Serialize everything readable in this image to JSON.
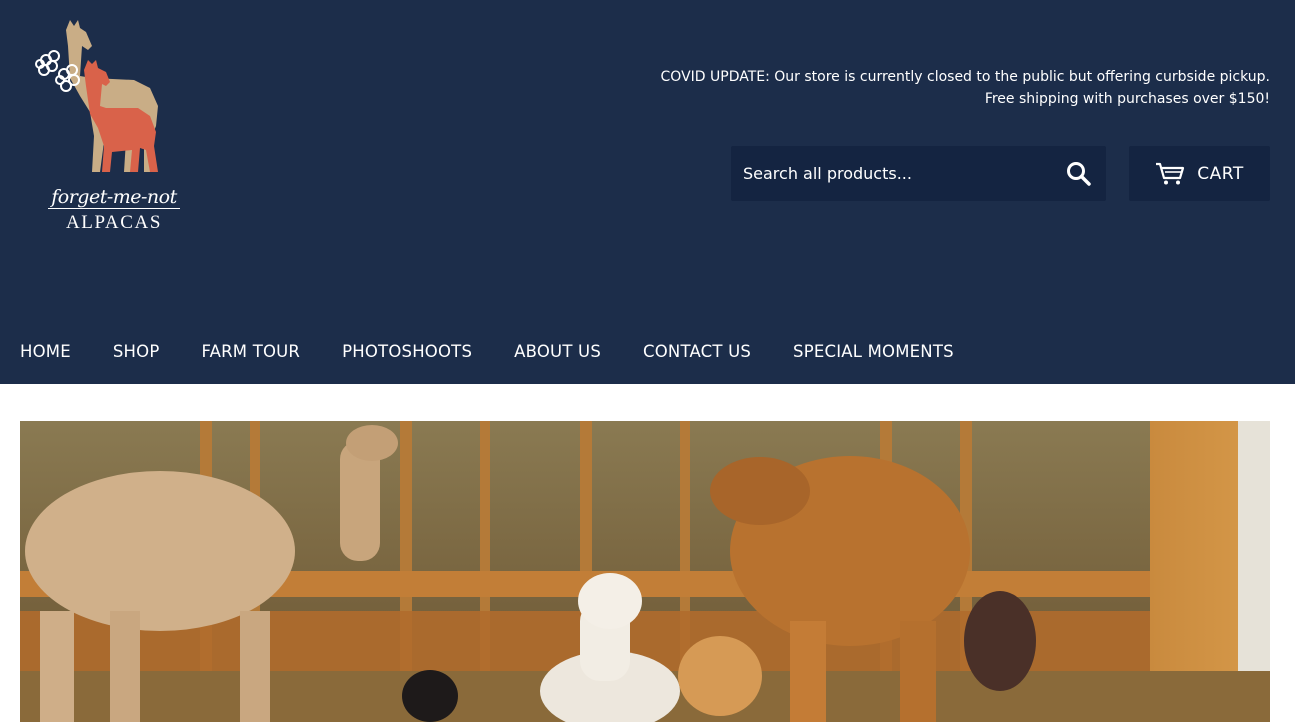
{
  "logo": {
    "line1": "forget-me-not",
    "line2": "ALPACAS"
  },
  "announcement": {
    "line1": "COVID UPDATE: Our store is currently closed to the public but offering curbside pickup.",
    "line2": "Free shipping with purchases over $150!"
  },
  "search": {
    "placeholder": "Search all products...",
    "icon": "search-icon"
  },
  "cart": {
    "label": "CART",
    "icon": "cart-icon"
  },
  "nav": {
    "items": [
      "HOME",
      "SHOP",
      "FARM TOUR",
      "PHOTOSHOOTS",
      "ABOUT US",
      "CONTACT US",
      "SPECIAL MOMENTS"
    ]
  },
  "hero": {
    "image": "alpacas-in-barn-photo"
  },
  "colors": {
    "header_bg": "#1c2d4a",
    "button_bg": "#142441",
    "text": "#ffffff"
  }
}
